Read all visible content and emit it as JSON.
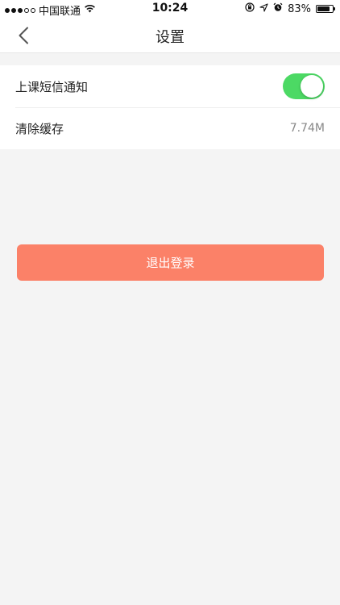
{
  "status_bar": {
    "carrier": "中国联通",
    "time": "10:24",
    "battery_percent": "83%",
    "battery_level": 0.83,
    "signal_filled": 3,
    "signal_total": 5
  },
  "nav": {
    "title": "设置",
    "back_icon": "chevron-left-icon"
  },
  "settings": {
    "items": [
      {
        "label": "上课短信通知",
        "control": "toggle",
        "on": true,
        "toggle_color": "#4cd964"
      },
      {
        "label": "清除缓存",
        "value": "7.74M"
      }
    ]
  },
  "logout": {
    "label": "退出登录",
    "color": "#fb8168"
  }
}
